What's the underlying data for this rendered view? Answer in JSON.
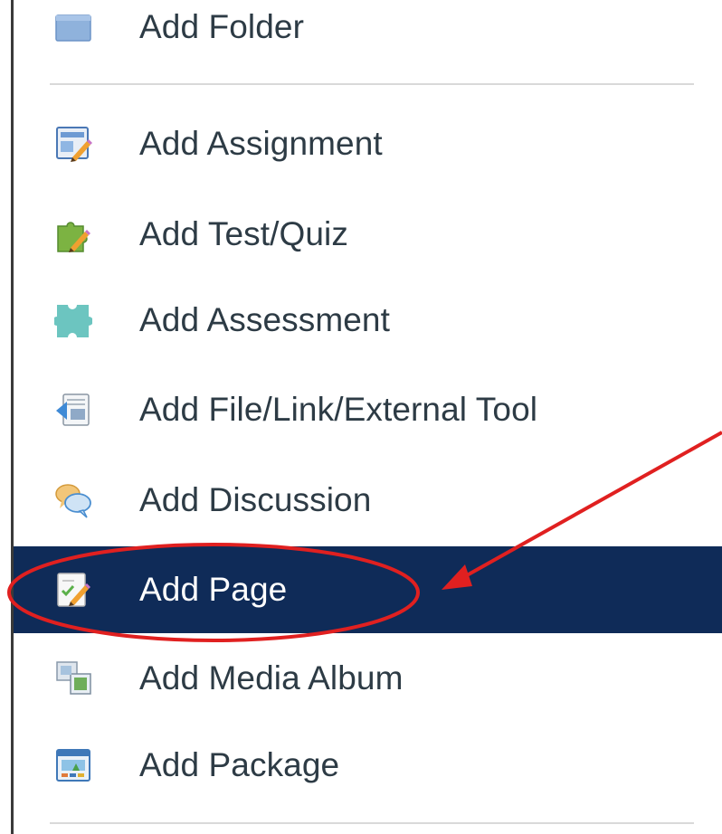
{
  "menu": {
    "items": [
      {
        "label": "Add Folder",
        "icon": "folder-icon"
      },
      {
        "label": "Add Assignment",
        "icon": "assignment-icon"
      },
      {
        "label": "Add Test/Quiz",
        "icon": "test-quiz-icon"
      },
      {
        "label": "Add Assessment",
        "icon": "assessment-icon"
      },
      {
        "label": "Add File/Link/External Tool",
        "icon": "file-link-icon"
      },
      {
        "label": "Add Discussion",
        "icon": "discussion-icon"
      },
      {
        "label": "Add Page",
        "icon": "page-icon",
        "selected": true
      },
      {
        "label": "Add Media Album",
        "icon": "media-album-icon"
      },
      {
        "label": "Add Package",
        "icon": "package-icon"
      }
    ]
  },
  "colors": {
    "selected_background": "#0f2b58",
    "text": "#2d3b45",
    "annotation": "#e02020"
  }
}
